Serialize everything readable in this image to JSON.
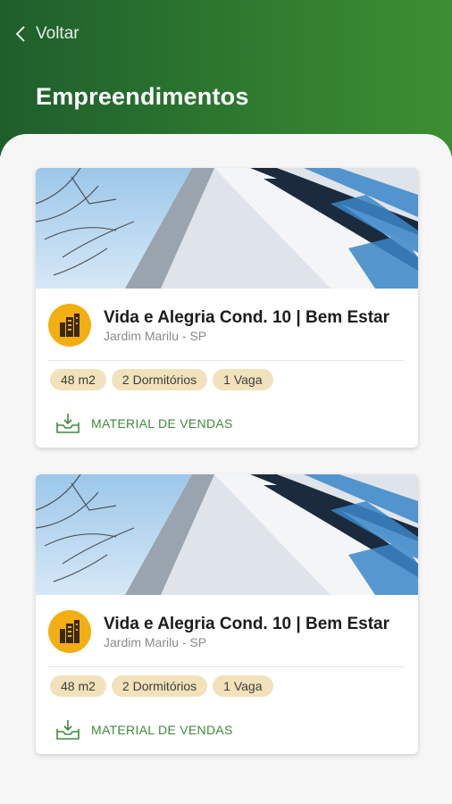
{
  "header": {
    "back_label": "Voltar",
    "title": "Empreendimentos",
    "gradient_start": "#1e5e2c",
    "gradient_end": "#3d8e32"
  },
  "accent_color": "#3f8a3b",
  "cards": [
    {
      "name": "Vida e Alegria Cond. 10 | Bem Estar",
      "location": "Jardim Marilu - SP",
      "chips": [
        "48 m2",
        "2 Dormitórios",
        "1 Vaga"
      ],
      "material_label": "MATERIAL DE VENDAS",
      "logo_icon": "building-icon",
      "material_icon": "download-tray-icon"
    },
    {
      "name": "Vida e Alegria Cond. 10 | Bem Estar",
      "location": "Jardim Marilu - SP",
      "chips": [
        "48 m2",
        "2 Dormitórios",
        "1 Vaga"
      ],
      "material_label": "MATERIAL DE VENDAS",
      "logo_icon": "building-icon",
      "material_icon": "download-tray-icon"
    }
  ]
}
